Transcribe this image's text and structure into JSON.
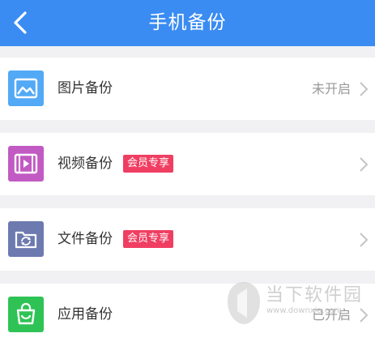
{
  "header": {
    "title": "手机备份",
    "back_icon": "chevron-left-icon"
  },
  "colors": {
    "header_bg": "#3a8cf3",
    "badge_bg": "#f03e62"
  },
  "rows": [
    {
      "label": "图片备份",
      "status": "未开启",
      "badge": "",
      "icon": "image-icon",
      "icon_color": "#52a9f6"
    },
    {
      "label": "视频备份",
      "status": "",
      "badge": "会员专享",
      "icon": "film-icon",
      "icon_color": "#c25ac3"
    },
    {
      "label": "文件备份",
      "status": "",
      "badge": "会员专享",
      "icon": "folder-sync-icon",
      "icon_color": "#6d7ab0"
    },
    {
      "label": "应用备份",
      "status": "已开启",
      "badge": "",
      "icon": "shopping-bag-icon",
      "icon_color": "#2fc356"
    }
  ],
  "watermark": {
    "text": "当下软件园",
    "url": "www.downxia.com"
  }
}
